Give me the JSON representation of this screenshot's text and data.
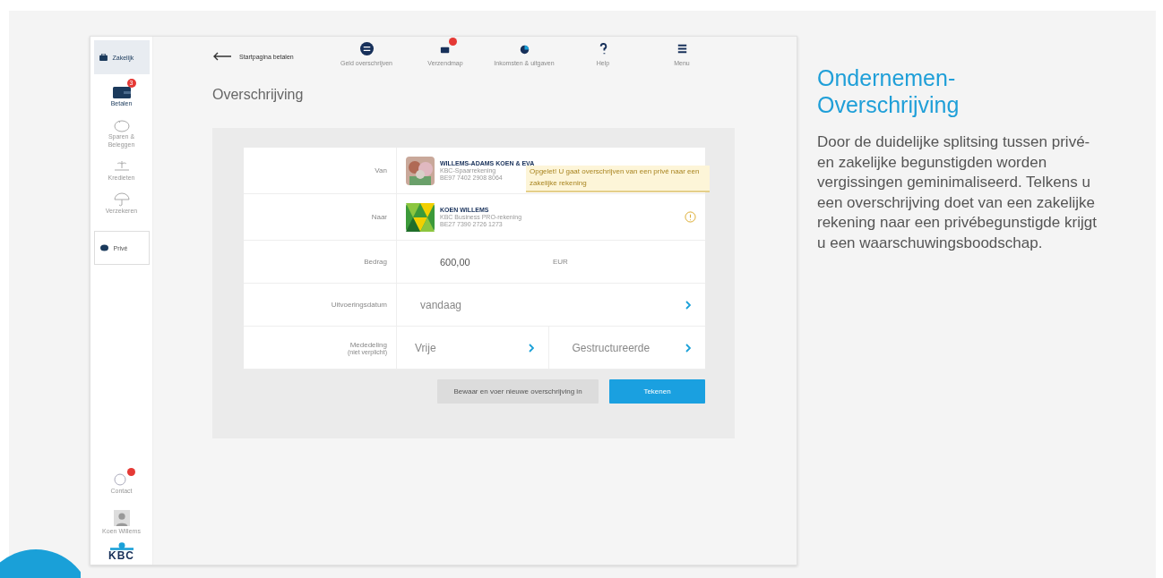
{
  "app": {
    "sidebar": {
      "items": [
        {
          "label": "Zakelijk",
          "kind": "toggle",
          "selected": true
        },
        {
          "label": "Betalen",
          "kind": "nav",
          "selected": true,
          "badge": "3"
        },
        {
          "label": "Sparen & Beleggen",
          "kind": "nav",
          "selected": false
        },
        {
          "label": "Kredieten",
          "kind": "nav",
          "selected": false
        },
        {
          "label": "Verzekeren",
          "kind": "nav",
          "selected": false
        },
        {
          "label": "Privé",
          "kind": "toggle",
          "selected": false
        }
      ],
      "bottom": [
        {
          "label": "Contact",
          "kind": "nav",
          "notification": true
        },
        {
          "label": "Koen Willems",
          "kind": "profile"
        }
      ],
      "logo": "KBC"
    },
    "topbar": {
      "back": "Startpagina betalen",
      "items": [
        {
          "label": "Geld overschrijven",
          "notification": false
        },
        {
          "label": "Verzendmap",
          "notification": true
        },
        {
          "label": "Inkomsten & uitgaven",
          "notification": false
        },
        {
          "label": "Help",
          "notification": false
        },
        {
          "label": "Menu",
          "notification": false
        }
      ]
    },
    "title": "Overschrijving",
    "form": {
      "from": {
        "label": "Van",
        "name": "WILLEMS-ADAMS KOEN & EVA",
        "account": "KBC-Spaarrekening",
        "number": "BE97 7402 2908 8064"
      },
      "to": {
        "label": "Naar",
        "name": "KOEN WILLEMS",
        "account": "KBC Business PRO-rekening",
        "number": "BE27 7390 2726 1273"
      },
      "amount": {
        "label": "Bedrag",
        "value": "600,00",
        "currency": "EUR"
      },
      "date": {
        "label": "Uitvoeringsdatum",
        "value": "vandaag"
      },
      "message": {
        "label": "Mededeling",
        "sublabel": "(niet verplicht)",
        "options": [
          "Vrije",
          "Gestructureerde"
        ]
      },
      "tooltip": "Opgelet! U gaat overschrijven van een privé naar een zakelijke rekening",
      "buttons": [
        {
          "label": "Bewaar en voer nieuwe overschrijving in",
          "kind": "secondary"
        },
        {
          "label": "Tekenen",
          "kind": "primary"
        }
      ]
    }
  },
  "article": {
    "heading": "Ondernemen-Overschrijving",
    "body": "Door de duidelijke splitsing tussen privé- en zakelijke begunstigden worden vergissingen geminimaliseerd. Telkens u een overschrijving doet van een zakelijke rekening naar een privébegunstigde krijgt u een waarschuwingsboodschap."
  }
}
